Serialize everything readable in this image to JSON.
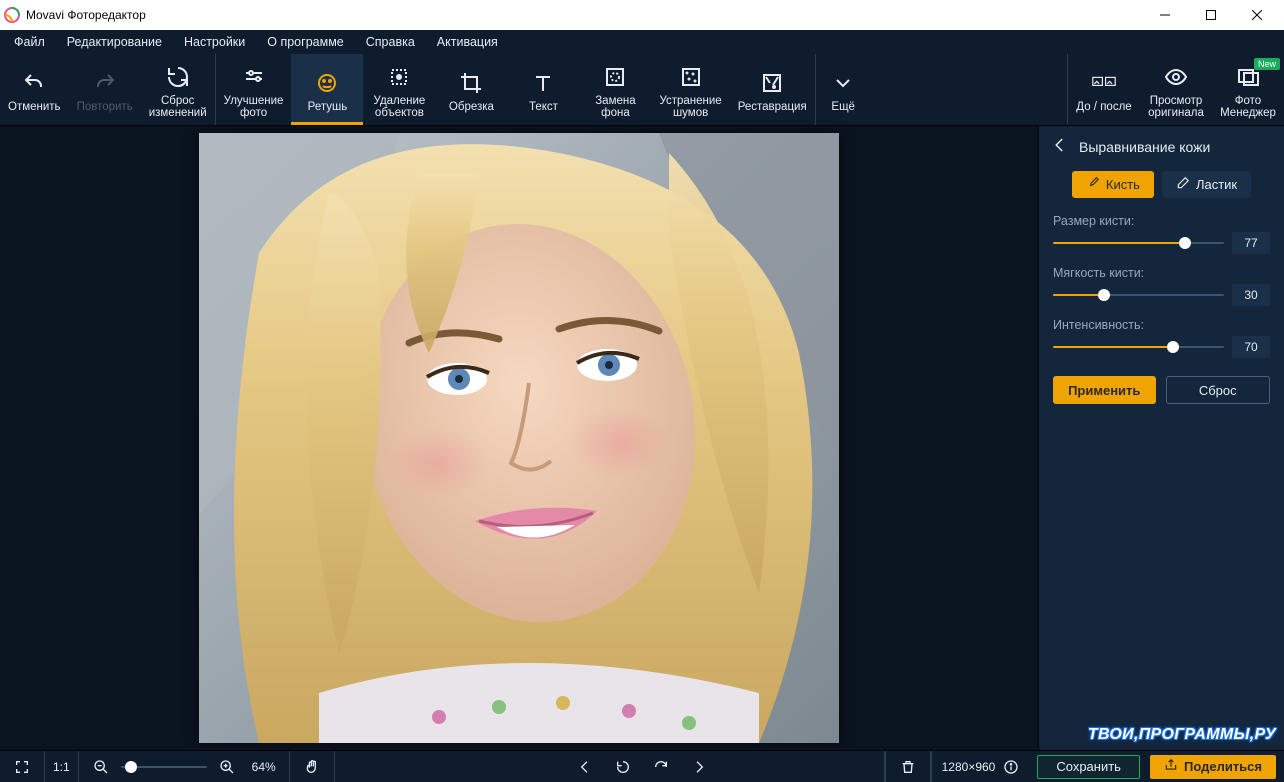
{
  "window": {
    "title": "Movavi Фоторедактор"
  },
  "menu": [
    "Файл",
    "Редактирование",
    "Настройки",
    "О программе",
    "Справка",
    "Активация"
  ],
  "toolbar_left": {
    "undo": "Отменить",
    "redo": "Повторить",
    "reset": "Сброс\nизменений"
  },
  "toolbar_tools": [
    {
      "id": "enhance",
      "label": "Улучшение\nфото"
    },
    {
      "id": "retouch",
      "label": "Ретушь",
      "selected": true
    },
    {
      "id": "erase",
      "label": "Удаление\nобъектов"
    },
    {
      "id": "crop",
      "label": "Обрезка"
    },
    {
      "id": "text",
      "label": "Текст"
    },
    {
      "id": "bgremove",
      "label": "Замена\nфона"
    },
    {
      "id": "denoise",
      "label": "Устранение\nшумов"
    },
    {
      "id": "restore",
      "label": "Реставрация"
    },
    {
      "id": "more",
      "label": "Ещё"
    }
  ],
  "toolbar_right": {
    "before_after": "До / после",
    "view_original": "Просмотр\nоригинала",
    "photo_manager": "Фото\nМенеджер",
    "new_badge": "New"
  },
  "side": {
    "title": "Выравнивание кожи",
    "brush": "Кисть",
    "eraser": "Ластик",
    "size_label": "Размер кисти:",
    "size_value": "77",
    "soft_label": "Мягкость кисти:",
    "soft_value": "30",
    "intensity_label": "Интенсивность:",
    "intensity_value": "70",
    "apply": "Применить",
    "reset": "Сброс"
  },
  "bottom": {
    "ratio": "1:1",
    "zoom": "64%",
    "dimensions": "1280×960",
    "save": "Сохранить",
    "share": "Поделиться"
  },
  "watermark": "ТВОИ,ПРОГРАММЫ,РУ"
}
